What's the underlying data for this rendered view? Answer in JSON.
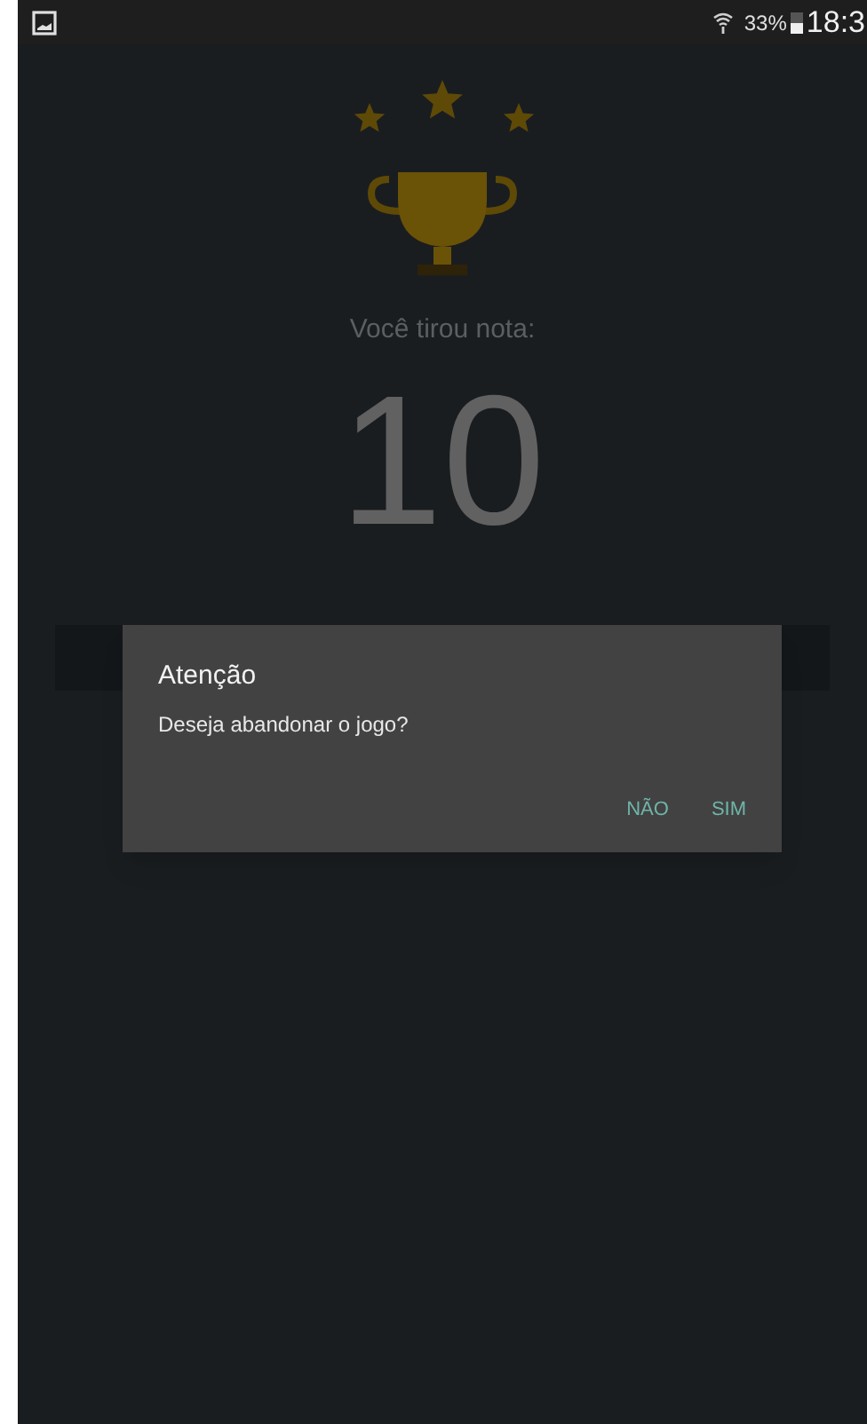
{
  "status_bar": {
    "battery": "33%",
    "time": "18:3"
  },
  "result": {
    "label": "Você tirou nota:",
    "score": "10"
  },
  "dialog": {
    "title": "Atenção",
    "message": "Deseja abandonar o jogo?",
    "buttons": [
      "NÃO",
      "SIM"
    ]
  }
}
